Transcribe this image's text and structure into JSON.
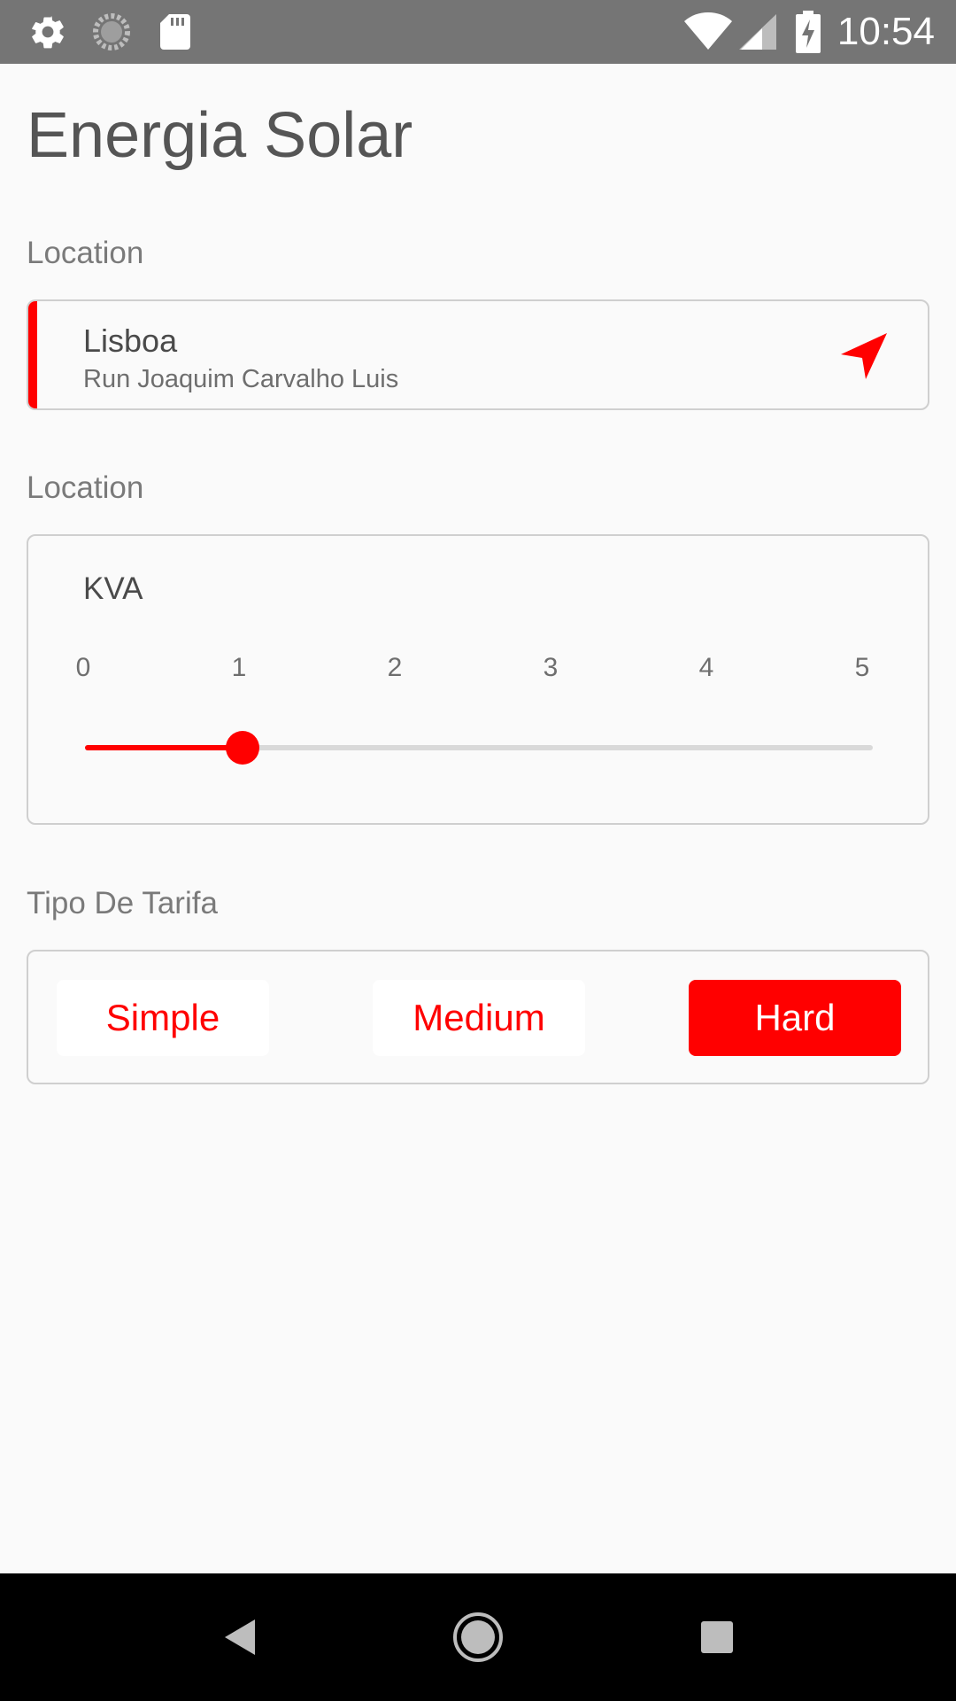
{
  "status_bar": {
    "time": "10:54",
    "icons": [
      "gear-icon",
      "sync-icon",
      "sd-card-icon",
      "wifi-icon",
      "signal-icon",
      "battery-charging-icon"
    ]
  },
  "page": {
    "title": "Energia Solar"
  },
  "location_section": {
    "label": "Location",
    "city": "Lisboa",
    "street": "Run Joaquim Carvalho Luis",
    "icon": "navigation-arrow-icon"
  },
  "kva_section": {
    "label": "Location",
    "title": "KVA",
    "ticks": [
      "0",
      "1",
      "2",
      "3",
      "4",
      "5"
    ],
    "min": 0,
    "max": 5,
    "value": 1
  },
  "tarifa_section": {
    "label": "Tipo De Tarifa",
    "options": [
      "Simple",
      "Medium",
      "Hard"
    ],
    "selected": "Hard"
  },
  "colors": {
    "accent": "#ff0000",
    "status_bar": "#757575",
    "background": "#fafafa"
  },
  "nav_bar": {
    "icons": [
      "back-icon",
      "home-icon",
      "recents-icon"
    ]
  }
}
